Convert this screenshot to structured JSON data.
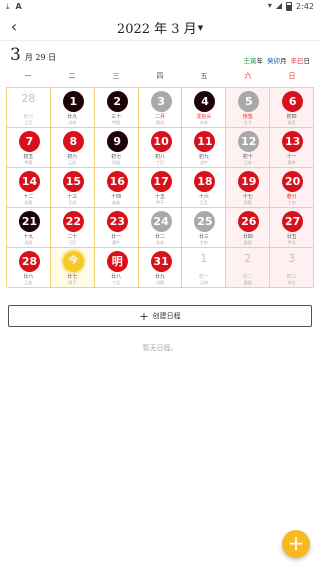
{
  "status_bar": {
    "left_icons": [
      "download-icon",
      "a-icon"
    ],
    "right_icons": [
      "wifi-icon",
      "signal-icon",
      "battery-icon"
    ],
    "time": "2:42"
  },
  "header": {
    "back_icon": "back-arrow-icon",
    "title": "2022 年 3 月",
    "caret_icon": "dropdown-caret-icon"
  },
  "selected_date": {
    "day": "3",
    "month_day": "月 29 日"
  },
  "ganzhi": {
    "year": "壬寅",
    "year_suffix": "年",
    "month": "癸卯",
    "month_suffix": "月",
    "day": "辛巳",
    "day_suffix": "日"
  },
  "weekdays": [
    "一",
    "二",
    "三",
    "四",
    "五",
    "六",
    "日"
  ],
  "calendar": {
    "rows": [
      [
        {
          "num": "28",
          "lunar": "廿六",
          "sub": "乙巳",
          "style": "plain"
        },
        {
          "num": "1",
          "lunar": "廿九",
          "sub": "戊申",
          "style": "black"
        },
        {
          "num": "2",
          "lunar": "三十",
          "sub": "甲酉",
          "style": "black"
        },
        {
          "num": "3",
          "lunar": "二月",
          "sub": "庚戌",
          "style": "gray",
          "fest": true
        },
        {
          "num": "4",
          "lunar": "龙抬头",
          "sub": "辛亥",
          "style": "black",
          "fest": true
        },
        {
          "num": "5",
          "lunar": "惊蛰",
          "sub": "壬子",
          "style": "gray",
          "fest": true
        },
        {
          "num": "6",
          "lunar": "初四",
          "sub": "癸丑",
          "style": "red"
        }
      ],
      [
        {
          "num": "7",
          "lunar": "初五",
          "sub": "甲寅",
          "style": "red"
        },
        {
          "num": "8",
          "lunar": "初六",
          "sub": "乙卯",
          "style": "red"
        },
        {
          "num": "9",
          "lunar": "初七",
          "sub": "丙辰",
          "style": "black"
        },
        {
          "num": "10",
          "lunar": "初八",
          "sub": "丁巳",
          "style": "red"
        },
        {
          "num": "11",
          "lunar": "初九",
          "sub": "戊午",
          "style": "red"
        },
        {
          "num": "12",
          "lunar": "初十",
          "sub": "己未",
          "style": "gray"
        },
        {
          "num": "13",
          "lunar": "十一",
          "sub": "庚申",
          "style": "red"
        }
      ],
      [
        {
          "num": "14",
          "lunar": "十二",
          "sub": "辛酉",
          "style": "red"
        },
        {
          "num": "15",
          "lunar": "十三",
          "sub": "壬戌",
          "style": "red"
        },
        {
          "num": "16",
          "lunar": "十四",
          "sub": "癸亥",
          "style": "red"
        },
        {
          "num": "17",
          "lunar": "十五",
          "sub": "甲子",
          "style": "red"
        },
        {
          "num": "18",
          "lunar": "十六",
          "sub": "乙丑",
          "style": "red"
        },
        {
          "num": "19",
          "lunar": "十七",
          "sub": "丙寅",
          "style": "red"
        },
        {
          "num": "20",
          "lunar": "春分",
          "sub": "丁卯",
          "style": "red",
          "fest": true
        }
      ],
      [
        {
          "num": "21",
          "lunar": "十九",
          "sub": "戊辰",
          "style": "black"
        },
        {
          "num": "22",
          "lunar": "二十",
          "sub": "己巳",
          "style": "red"
        },
        {
          "num": "23",
          "lunar": "廿一",
          "sub": "庚午",
          "style": "red"
        },
        {
          "num": "24",
          "lunar": "廿二",
          "sub": "辛未",
          "style": "gray"
        },
        {
          "num": "25",
          "lunar": "廿三",
          "sub": "壬申",
          "style": "gray"
        },
        {
          "num": "26",
          "lunar": "廿四",
          "sub": "癸酉",
          "style": "red"
        },
        {
          "num": "27",
          "lunar": "廿五",
          "sub": "甲戌",
          "style": "red"
        }
      ],
      [
        {
          "num": "28",
          "lunar": "廿六",
          "sub": "乙亥",
          "style": "red"
        },
        {
          "num": "今",
          "lunar": "廿七",
          "sub": "丙子",
          "style": "yellow",
          "today": true
        },
        {
          "num": "明",
          "lunar": "廿八",
          "sub": "丁丑",
          "style": "red"
        },
        {
          "num": "31",
          "lunar": "廿九",
          "sub": "戊寅",
          "style": "red"
        },
        {
          "num": "1",
          "lunar": "初一",
          "sub": "己卯",
          "style": "plain"
        },
        {
          "num": "2",
          "lunar": "初二",
          "sub": "庚辰",
          "style": "plain"
        },
        {
          "num": "3",
          "lunar": "初三",
          "sub": "辛巳",
          "style": "plain"
        }
      ]
    ]
  },
  "create_button": {
    "icon": "plus-icon",
    "label": "创建日程"
  },
  "empty_text": "暂无日程。",
  "fab": {
    "icon": "plus-icon"
  },
  "colors": {
    "red": "#d8101a",
    "black": "#1c0308",
    "gray": "#a9a9a9",
    "today": "#f7c927",
    "grid_line": "#f3d27a",
    "weekend_bg": "#fff1f1",
    "fab": "#f7b91f"
  }
}
